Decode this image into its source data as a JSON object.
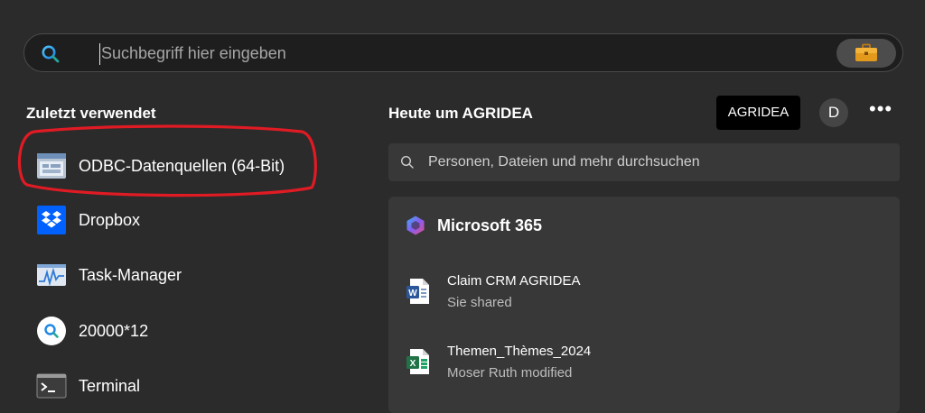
{
  "search": {
    "placeholder": "Suchbegriff hier eingeben"
  },
  "recent": {
    "title": "Zuletzt verwendet",
    "items": [
      {
        "label": "ODBC-Datenquellen (64-Bit)",
        "icon": "odbc-icon"
      },
      {
        "label": "Dropbox",
        "icon": "dropbox-icon"
      },
      {
        "label": "Task-Manager",
        "icon": "task-manager-icon"
      },
      {
        "label": "20000*12",
        "icon": "search-result-icon"
      },
      {
        "label": "Terminal",
        "icon": "terminal-icon"
      }
    ]
  },
  "today": {
    "title": "Heute um AGRIDEA",
    "org_button": "AGRIDEA",
    "avatar_initial": "D",
    "more_label": "•••",
    "people_search_placeholder": "Personen, Dateien und mehr durchsuchen"
  },
  "m365": {
    "title": "Microsoft 365",
    "items": [
      {
        "name": "Claim CRM AGRIDEA",
        "sub": "Sie shared",
        "icon": "word-icon"
      },
      {
        "name": "Themen_Thèmes_2024",
        "sub": "Moser Ruth modified",
        "icon": "excel-icon"
      }
    ]
  },
  "colors": {
    "background": "#2b2b2b",
    "panel": "#383838",
    "annotation_red": "#e01b24",
    "word_blue": "#2b579a",
    "excel_green": "#217346"
  }
}
